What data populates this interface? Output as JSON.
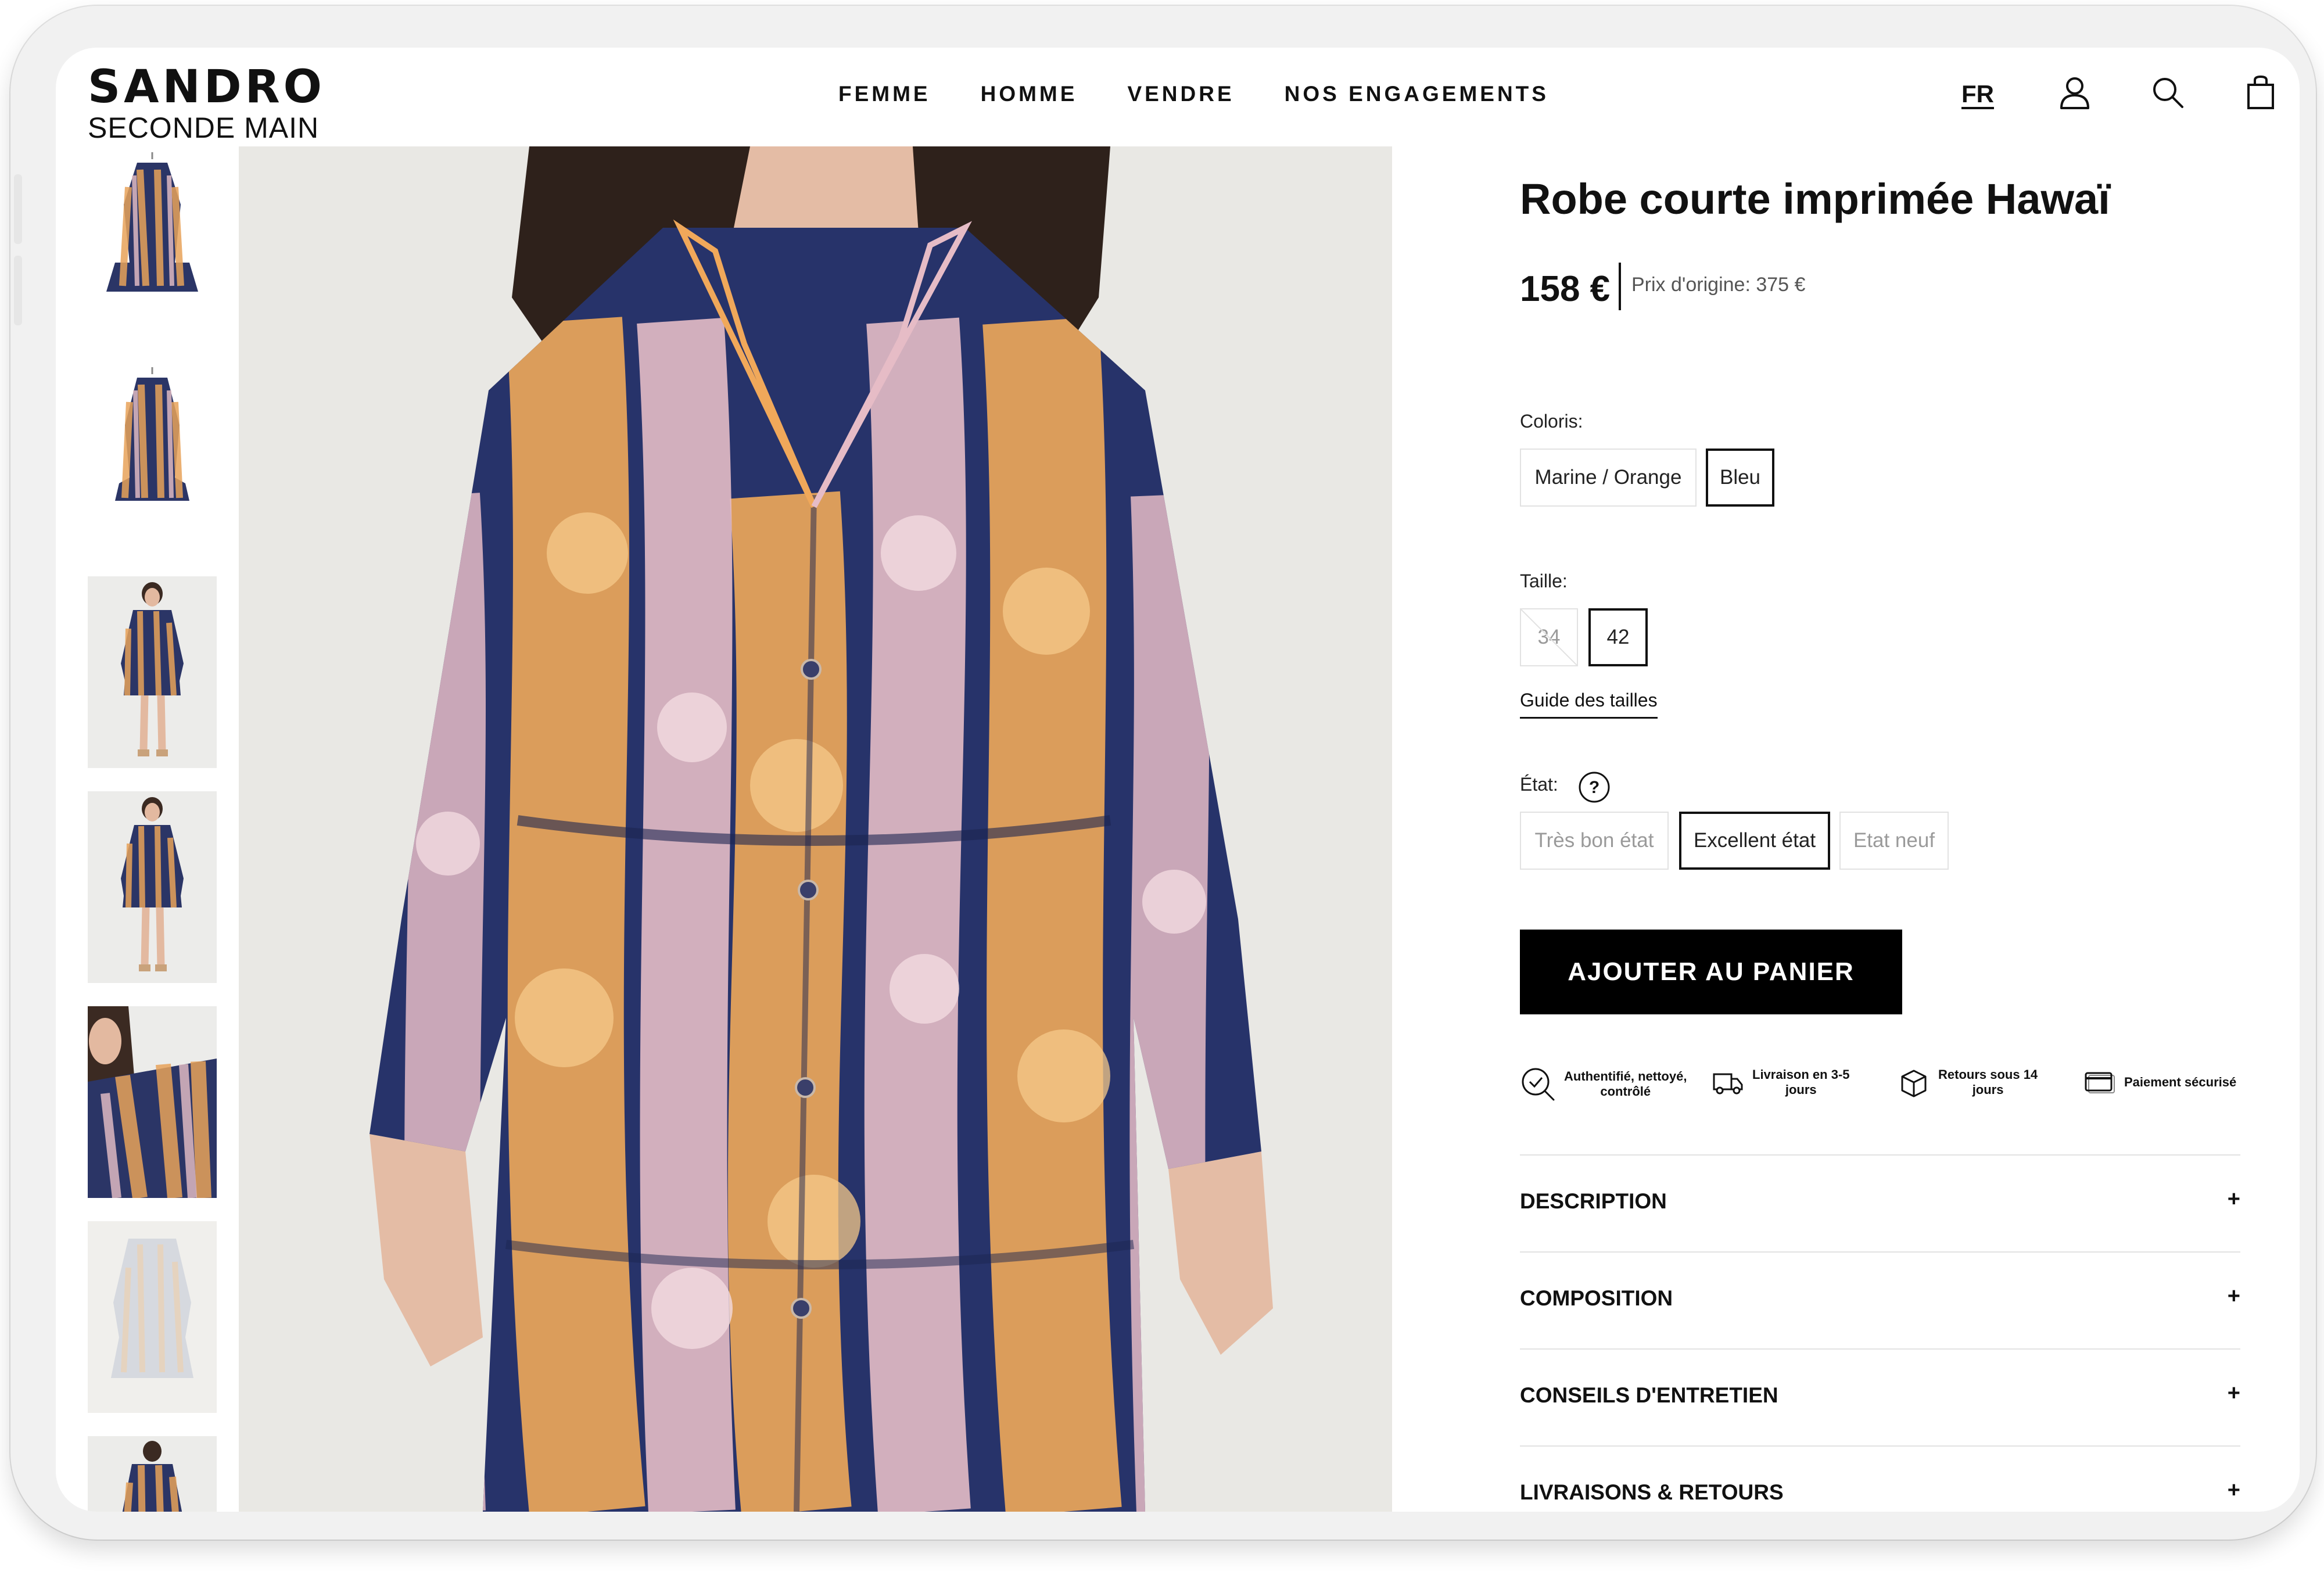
{
  "header": {
    "logo_line1": "SANDRO",
    "logo_line2": "SECONDE MAIN",
    "nav": [
      "FEMME",
      "HOMME",
      "VENDRE",
      "NOS ENGAGEMENTS"
    ],
    "lang": "FR",
    "icons": [
      "account-icon",
      "search-icon",
      "bag-icon"
    ]
  },
  "gallery": {
    "thumbnail_count": 7,
    "selected_thumbnail": 5
  },
  "product": {
    "title": "Robe courte imprimée Hawaï",
    "price": "158 €",
    "original_price": "Prix d'origine: 375 €",
    "colors_label": "Coloris:",
    "colors": [
      {
        "label": "Marine / Orange",
        "selected": false
      },
      {
        "label": "Bleu",
        "selected": true
      }
    ],
    "size_label": "Taille:",
    "sizes": [
      {
        "label": "34",
        "available": false
      },
      {
        "label": "42",
        "selected": true
      }
    ],
    "size_guide": "Guide des tailles",
    "condition_label": "État:",
    "conditions": [
      {
        "label": "Très bon état",
        "available": false
      },
      {
        "label": "Excellent état",
        "selected": true
      },
      {
        "label": "Etat neuf",
        "available": false
      }
    ],
    "add_to_cart": "AJOUTER AU PANIER",
    "features": [
      {
        "icon": "magnifier-check-icon",
        "line1": "Authentifié, nettoyé,",
        "line2": "contrôlé"
      },
      {
        "icon": "truck-icon",
        "line1": "Livraison en 3-5",
        "line2": "jours"
      },
      {
        "icon": "box-icon",
        "line1": "Retours sous 14",
        "line2": "jours"
      },
      {
        "icon": "card-icon",
        "line1": "Paiement sécurisé",
        "line2": ""
      }
    ],
    "accordions": [
      "DESCRIPTION",
      "COMPOSITION",
      "CONSEILS D'ENTRETIEN",
      "LIVRAISONS & RETOURS"
    ],
    "accordion_toggle": "+"
  }
}
